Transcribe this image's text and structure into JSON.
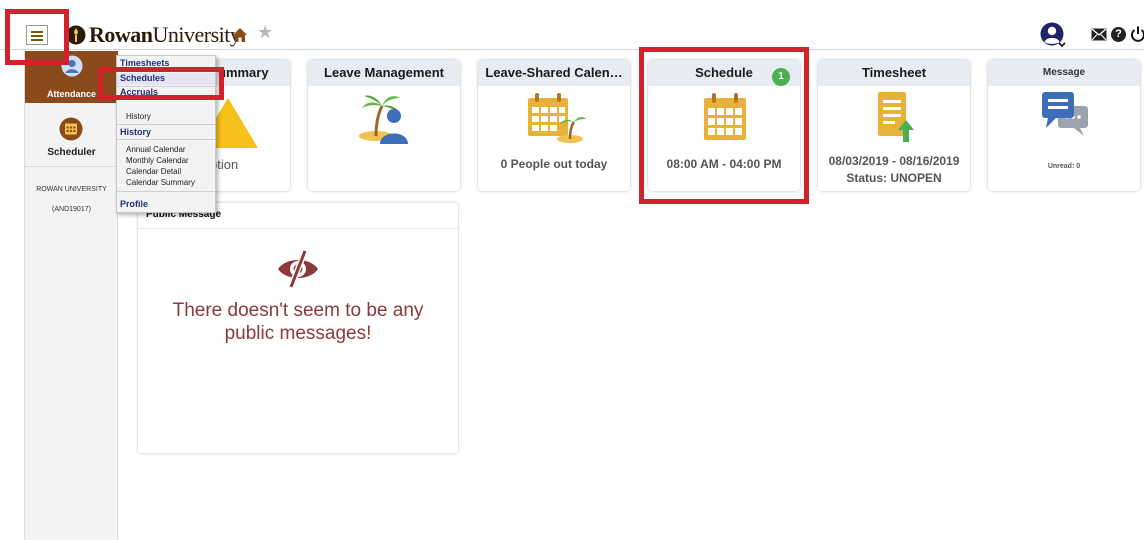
{
  "header": {
    "logo_prefix": "Rowan",
    "logo_suffix": "University"
  },
  "sidebar": {
    "attendance": "Attendance",
    "scheduler": "Scheduler",
    "org_name": "ROWAN UNIVERSITY",
    "org_code": "(AND19017)"
  },
  "menu": {
    "timesheets": "Timesheets",
    "schedules": "Schedules",
    "accruals": "Accruals",
    "accruals_history": "History",
    "history": "History",
    "annual_calendar": "Annual Calendar",
    "monthly_calendar": "Monthly Calendar",
    "calendar_detail": "Calendar Detail",
    "calendar_summary": "Calendar Summary",
    "profile": "Profile"
  },
  "widgets": {
    "summary": {
      "title": "ummary",
      "text": "ption"
    },
    "leave": {
      "title": "Leave Management"
    },
    "shared": {
      "title": "Leave-Shared Calen…",
      "text": "0 People out today"
    },
    "schedule": {
      "title": "Schedule",
      "badge": "1",
      "text": "08:00 AM - 04:00 PM"
    },
    "timesheet": {
      "title": "Timesheet",
      "dates": "08/03/2019 - 08/16/2019",
      "status": "Status: UNOPEN"
    },
    "message": {
      "title": "Message",
      "unread": "Unread: 0"
    }
  },
  "public_message": {
    "title": "Public Message",
    "empty_line1": "There doesn't seem to be any",
    "empty_line2": "public messages!"
  },
  "colors": {
    "brand": "#8b4a1c",
    "highlight": "#d4202a",
    "calendar": "#e8b23a",
    "badge": "#4caf50"
  }
}
